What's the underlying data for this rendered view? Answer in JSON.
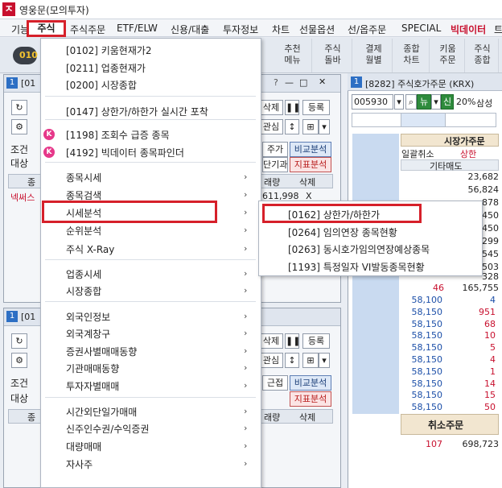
{
  "app": {
    "title": "영웅문(모의투자)",
    "icon": "logo-icon"
  },
  "menubar": {
    "items": [
      "기능",
      "주식",
      "주식주문",
      "ETF/ELW",
      "신용/대출",
      "투자정보",
      "차트",
      "선물옵션",
      "선/옵주문",
      "SPECIAL",
      "빅데이터",
      "트"
    ]
  },
  "toolbar": {
    "pill": "010",
    "buttons": [
      {
        "line1": "추천",
        "line2": "메뉴"
      },
      {
        "line1": "주식",
        "line2": "돌바"
      },
      {
        "line1": "결제",
        "line2": "월별"
      },
      {
        "line1": "종합",
        "line2": "차트"
      },
      {
        "line1": "키움",
        "line2": "주문"
      },
      {
        "line1": "주식",
        "line2": "종합"
      }
    ]
  },
  "window1": {
    "num": "1",
    "code_prefix": "[01",
    "btn_delete": "삭제",
    "btn_register": "등록",
    "btn_interest": "관심",
    "btn_add": "주가",
    "btn_compare": "비교분석",
    "btn_single": "단기과",
    "btn_indicator": "지표분석",
    "label_cond": "조건",
    "label_target": "대상",
    "col_item": "종",
    "col_amount": "래량",
    "col_del": "삭제",
    "row_name": "넥써스",
    "row_amount": "611,998",
    "row_del": "X"
  },
  "window2": {
    "num": "1",
    "code_prefix": "[01",
    "btn_delete": "삭제",
    "btn_register": "등록",
    "btn_interest": "관심",
    "btn_near": "근접",
    "btn_compare": "비교분석",
    "btn_indicator": "지표분석",
    "label_cond": "조건",
    "label_target": "대상",
    "col_item": "종",
    "col_amount": "래량",
    "col_del": "삭제"
  },
  "orderbook": {
    "title": "[8282] 주식호가주문 (KRX)",
    "num": "1",
    "code": "005930",
    "btn_new": "뉴",
    "btn_credit": "신",
    "ratio": "20%",
    "name": "삼성",
    "market_order": "시장가주문",
    "cancel_all": "일괄취소",
    "upper_limit": "상한",
    "other_sell": "기타매도",
    "top_qty": [
      "23,682",
      "56,824",
      "878",
      "450",
      "450",
      "299",
      "545",
      "503",
      "328"
    ],
    "row_46": {
      "price": "46",
      "qty": "165,755"
    },
    "rows": [
      {
        "price": "58,100",
        "qty": "4"
      },
      {
        "price": "58,150",
        "qty": "951"
      },
      {
        "price": "58,150",
        "qty": "68"
      },
      {
        "price": "58,150",
        "qty": "10"
      },
      {
        "price": "58,150",
        "qty": "5"
      },
      {
        "price": "58,150",
        "qty": "4"
      },
      {
        "price": "58,150",
        "qty": "1"
      },
      {
        "price": "58,150",
        "qty": "14"
      },
      {
        "price": "58,150",
        "qty": "15"
      },
      {
        "price": "58,150",
        "qty": "50"
      }
    ],
    "cancel_order": "취소주문",
    "bottom": {
      "price": "107",
      "qty": "698,723"
    }
  },
  "dropdown": {
    "items": [
      {
        "label": "[0102] 키움현재가2",
        "arrow": false
      },
      {
        "label": "[0211] 업종현재가",
        "arrow": false
      },
      {
        "label": "[0200] 시장종합",
        "arrow": false
      },
      {
        "label": "[0147] 상한가/하한가 실시간 포착",
        "arrow": false
      },
      {
        "label": "[1198] 조회수 급증 종목",
        "arrow": false
      },
      {
        "label": "[4192] 빅데이터 종목파인더",
        "arrow": false
      },
      {
        "label": "종목시세",
        "arrow": true
      },
      {
        "label": "종목검색",
        "arrow": true
      },
      {
        "label": "시세분석",
        "arrow": true
      },
      {
        "label": "순위분석",
        "arrow": true
      },
      {
        "label": "주식 X-Ray",
        "arrow": true
      },
      {
        "label": "업종시세",
        "arrow": true
      },
      {
        "label": "시장종합",
        "arrow": true
      },
      {
        "label": "외국인정보",
        "arrow": true
      },
      {
        "label": "외국계창구",
        "arrow": true
      },
      {
        "label": "증권사별매매동향",
        "arrow": true
      },
      {
        "label": "기관매매동향",
        "arrow": true
      },
      {
        "label": "투자자별매매",
        "arrow": true
      },
      {
        "label": "시간외단일가매매",
        "arrow": true
      },
      {
        "label": "신주인수권/수익증권",
        "arrow": true
      },
      {
        "label": "대량매매",
        "arrow": true
      },
      {
        "label": "자사주",
        "arrow": true
      }
    ],
    "bulb_glyph": "K"
  },
  "submenu": {
    "items": [
      "[0162] 상한가/하한가",
      "[0264] 임의연장 종목현황",
      "[0263] 동시호가임의연장예상종목",
      "[1193] 특정일자 VI발동종목현황"
    ]
  },
  "colors": {
    "highlight": "#d6202a",
    "accent_blue": "#2d6fc4",
    "price_blue": "#1c4fa8",
    "price_red": "#c8102e"
  }
}
